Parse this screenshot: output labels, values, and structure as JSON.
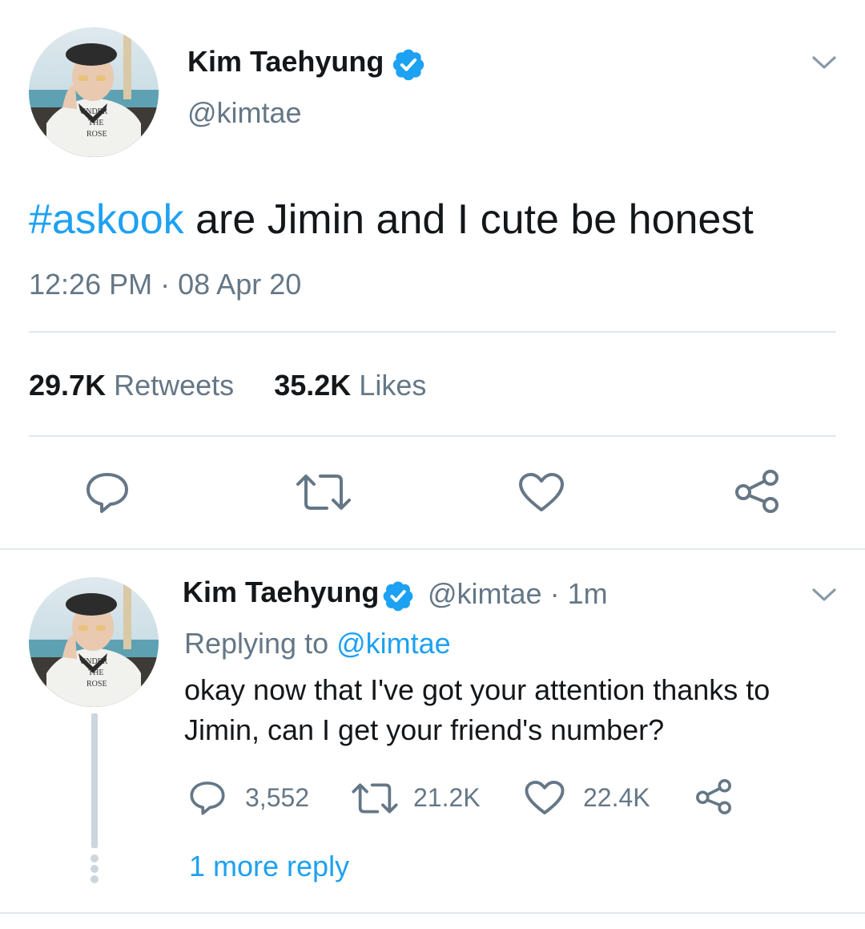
{
  "main_tweet": {
    "display_name": "Kim Taehyung",
    "handle": "@kimtae",
    "hashtag": "#askook",
    "text": " are Jimin and I cute be honest",
    "time": "12:26 PM",
    "separator": "·",
    "date": "08 Apr 20",
    "retweets_count": "29.7K",
    "retweets_label": "Retweets",
    "likes_count": "35.2K",
    "likes_label": "Likes",
    "avatar_shirt_text": [
      "UNDER",
      "THE",
      "ROSE"
    ]
  },
  "reply_tweet": {
    "display_name": "Kim Taehyung",
    "handle_time": "@kimtae · 1m",
    "replying_prefix": "Replying to ",
    "replying_handle": "@kimtae",
    "text_line1": "okay now that I've got your attention thanks to",
    "text_line2": "Jimin, can I get your friend's number?",
    "reply_count": "3,552",
    "retweet_count": "21.2K",
    "like_count": "22.4K",
    "more_replies": "1 more reply",
    "avatar_shirt_text": [
      "UNDER",
      "THE",
      "ROSE"
    ]
  },
  "colors": {
    "accent": "#1da1f2",
    "text": "#14171a",
    "secondary": "#657786",
    "divider": "#e1e8ed",
    "thread_line": "#ccd6dd"
  },
  "icons": [
    "verified-badge-icon",
    "chevron-down-icon",
    "reply-icon",
    "retweet-icon",
    "like-icon",
    "share-icon"
  ]
}
